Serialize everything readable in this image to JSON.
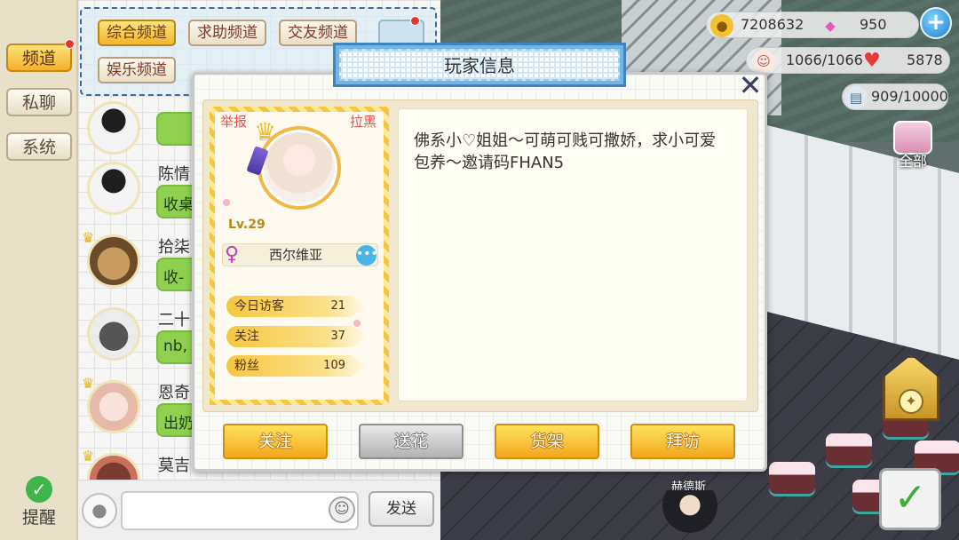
{
  "sidebar": {
    "items": [
      {
        "label": "频道"
      },
      {
        "label": "私聊"
      },
      {
        "label": "系统"
      }
    ],
    "remind_label": "提醒"
  },
  "channels": [
    {
      "label": "综合频道"
    },
    {
      "label": "求助频道"
    },
    {
      "label": "交友频道"
    },
    {
      "label": "娱乐频道"
    }
  ],
  "chat": {
    "messages": [
      {
        "name": "",
        "bubble": ""
      },
      {
        "name": "陈情",
        "bubble": "收桌"
      },
      {
        "name": "拾柒",
        "bubble": "收-"
      },
      {
        "name": "二十",
        "bubble": "nb,"
      },
      {
        "name": "恩奇",
        "bubble": "出奶"
      },
      {
        "name": "莫吉",
        "bubble": ""
      }
    ],
    "send_label": "发送"
  },
  "hud": {
    "gold": "7208632",
    "gems": "950",
    "energy": "1066/1066",
    "hearts": "5878",
    "storage": "909/10000",
    "all_label": "全部"
  },
  "scene": {
    "character_name": "赫德斯"
  },
  "modal": {
    "title": "玩家信息",
    "report_label": "举报",
    "block_label": "拉黑",
    "level": "Lv.29",
    "name": "西尔维亚",
    "stats": [
      {
        "label": "今日访客",
        "value": "21"
      },
      {
        "label": "关注",
        "value": "37"
      },
      {
        "label": "粉丝",
        "value": "109"
      }
    ],
    "signature": "佛系小♡姐姐～可萌可贱可撒娇，求小可爱包养～邀请码FHAN5",
    "buttons": [
      {
        "label": "关注"
      },
      {
        "label": "送花"
      },
      {
        "label": "货架"
      },
      {
        "label": "拜访"
      }
    ]
  },
  "colors": {
    "accent_yellow": "#f2b02a",
    "chat_bubble_green": "#8fd14f",
    "title_blue": "#6fb5e6",
    "warning_red": "#e3524f"
  }
}
